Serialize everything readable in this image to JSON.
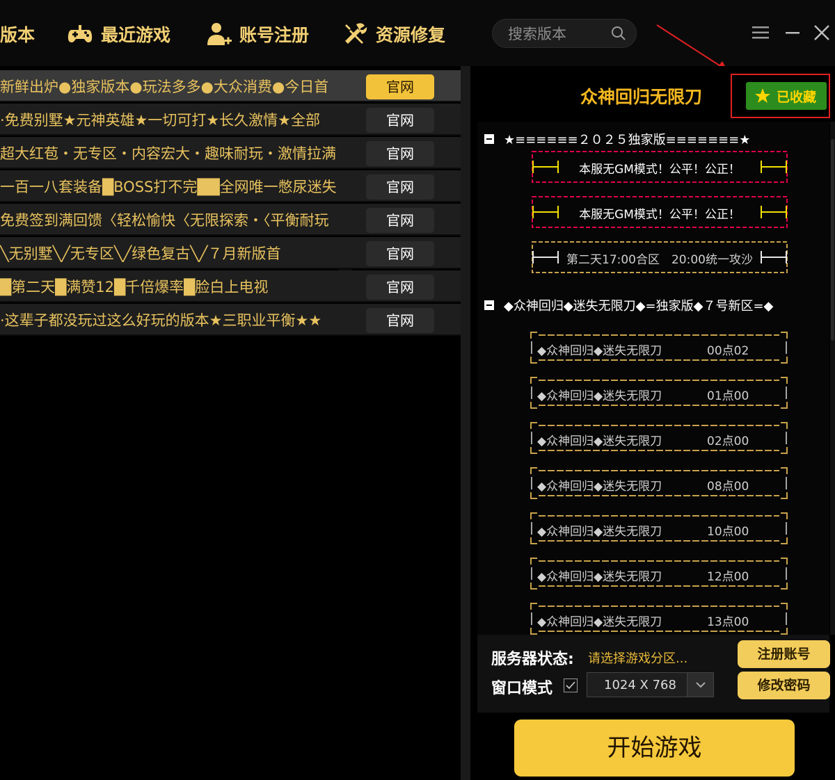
{
  "nav": {
    "partial_title": "版本",
    "recent_games": "最近游戏",
    "account_register": "账号注册",
    "resource_repair": "资源修复",
    "search_placeholder": "搜索版本"
  },
  "game_list": [
    {
      "title": "新鲜出炉●独家版本●玩法多多●大众消费●今日首",
      "button": "官网",
      "selected": true
    },
    {
      "title": "·免费别墅★元神英雄★一切可打★长久激情★全部",
      "button": "官网"
    },
    {
      "title": "超大红苞・无专区・内容宏大・趣味耐玩・激情拉满",
      "button": "官网"
    },
    {
      "title": "一百一八套装备█BOSS打不完██全网唯一憋尿迷失",
      "button": "官网"
    },
    {
      "title": "免费签到满回馈〈轻松愉快〈无限探索・〈平衡耐玩",
      "button": "官网"
    },
    {
      "title": "╲无别墅╲╱无专区╲╱绿色复古╲╱７月新版首",
      "button": "官网"
    },
    {
      "title": "█第二天█满赞12█千倍爆率█脸白上电视",
      "button": "官网"
    },
    {
      "title": "·这辈子都没玩过这么好玩的版本★三职业平衡★★",
      "button": "官网"
    }
  ],
  "detail": {
    "server_name": "众神回归无限刀",
    "favorite_label": "已收藏",
    "group1_title": "★≡≡≡≡≡≡２０２５独家版≡≡≡≡≡≡≡★",
    "notices": [
      "本服无GM模式！公平！公正！",
      "本服无GM模式！公平！公正！",
      "第二天17:00合区　20:00统一攻沙"
    ],
    "group2_title": "◆众神回归◆迷失无限刀◆=独家版◆７号新区=◆",
    "zones": [
      {
        "name": "◆众神回归◆迷失无限刀",
        "time": "00点02"
      },
      {
        "name": "◆众神回归◆迷失无限刀",
        "time": "01点00"
      },
      {
        "name": "◆众神回归◆迷失无限刀",
        "time": "02点00"
      },
      {
        "name": "◆众神回归◆迷失无限刀",
        "time": "08点00"
      },
      {
        "name": "◆众神回归◆迷失无限刀",
        "time": "10点00"
      },
      {
        "name": "◆众神回归◆迷失无限刀",
        "time": "12点00"
      },
      {
        "name": "◆众神回归◆迷失无限刀",
        "time": "13点00"
      }
    ]
  },
  "controls": {
    "server_status_label": "服务器状态:",
    "server_status_value": "请选择游戏分区...",
    "window_mode_label": "窗口模式",
    "window_mode_checked": true,
    "resolution": "1024 X 768",
    "register_button": "注册账号",
    "change_password_button": "修改密码",
    "start_button": "开始游戏"
  },
  "colors": {
    "accent_gold": "#f2c23a",
    "favorite_green": "#2d8c1e",
    "highlight_red": "#e02020",
    "notice_border_magenta": "#e0004a",
    "zone_border_gold": "#c8a24a"
  },
  "icons": [
    "gamepad-icon",
    "user-add-icon",
    "tools-icon",
    "search-icon",
    "menu-icon",
    "minimize-icon",
    "close-icon",
    "star-icon",
    "checkbox-check-icon",
    "chevron-down-icon",
    "tree-collapse-icon"
  ]
}
